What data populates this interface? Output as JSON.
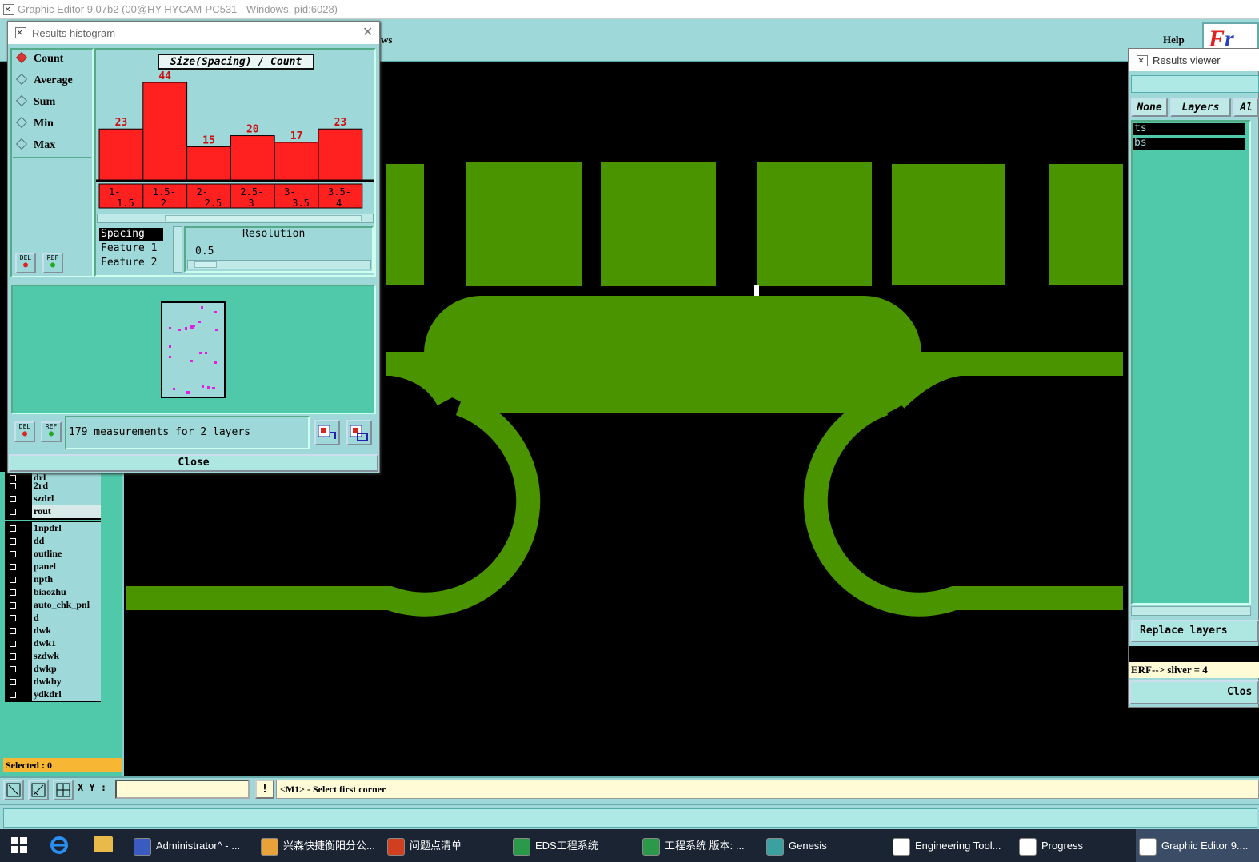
{
  "window_title": "Graphic Editor 9.07b2 (00@HY-HYCAM-PC531 - Windows, pid:6028)",
  "menu": {
    "partial_item": "ws",
    "help": "Help",
    "logo": "Fr"
  },
  "histogram_dialog": {
    "title": "Results histogram",
    "modes": [
      {
        "label": "Count",
        "selected": true
      },
      {
        "label": "Average",
        "selected": false
      },
      {
        "label": "Sum",
        "selected": false
      },
      {
        "label": "Min",
        "selected": false
      },
      {
        "label": "Max",
        "selected": false
      }
    ],
    "del_label": "DEL",
    "ref_label": "REF",
    "measure_list": [
      "Spacing",
      "Feature 1",
      "Feature 2"
    ],
    "resolution_label": "Resolution",
    "resolution_value": "0.5",
    "summary": "179 measurements for 2 layers",
    "close_label": "Close"
  },
  "chart_data": {
    "type": "bar",
    "title": "Size(Spacing) / Count",
    "categories": [
      "1-\n1.5",
      "1.5-\n2",
      "2-\n2.5",
      "2.5-\n3",
      "3-\n3.5",
      "3.5-\n4"
    ],
    "values": [
      23,
      44,
      15,
      20,
      17,
      23
    ],
    "bar_color": "#ff2020",
    "label_color": "#cc1010"
  },
  "results_viewer": {
    "title": "Results viewer",
    "tabs": [
      "None",
      "Layers",
      "Al"
    ],
    "layers": [
      "ts",
      "bs"
    ],
    "replace_label": "Replace layers",
    "erf_text": "ERF--> sliver = 4",
    "close_label": "Clos"
  },
  "layer_list": {
    "group1": [
      "drl",
      "2rd",
      "szdrl",
      "rout"
    ],
    "group2": [
      "1npdrl",
      "dd",
      "outline",
      "panel",
      "npth",
      "biaozhu",
      "auto_chk_pnl",
      "d",
      "dwk",
      "dwk1",
      "szdwk",
      "dwkp",
      "dwkby",
      "ydkdrl"
    ],
    "selected_text": "Selected : 0"
  },
  "command_bar": {
    "xy_label": "X Y :",
    "xy_value": "",
    "warn_label": "!",
    "prompt": "<M1> - Select first corner"
  },
  "taskbar": [
    {
      "label": "Administrator^ - ...",
      "icon": "save-icon",
      "color": "#3a5bbf"
    },
    {
      "label": "兴森快捷衡阳分公...",
      "icon": "shell-icon",
      "color": "#e8a23a"
    },
    {
      "label": "问题点清单",
      "icon": "office-icon",
      "color": "#d04020"
    },
    {
      "label": "EDS工程系统",
      "icon": "eds-icon",
      "color": "#2a9a4a"
    },
    {
      "label": "工程系统  版本: ...",
      "icon": "p-icon",
      "color": "#2a9a4a"
    },
    {
      "label": "Genesis",
      "icon": "genesis-icon",
      "color": "#3aa0a0"
    },
    {
      "label": "Engineering Tool...",
      "icon": "app-icon",
      "color": "#ffffff"
    },
    {
      "label": "Progress",
      "icon": "app-icon",
      "color": "#ffffff"
    },
    {
      "label": "Graphic Editor 9....",
      "icon": "app-icon",
      "color": "#ffffff"
    }
  ]
}
